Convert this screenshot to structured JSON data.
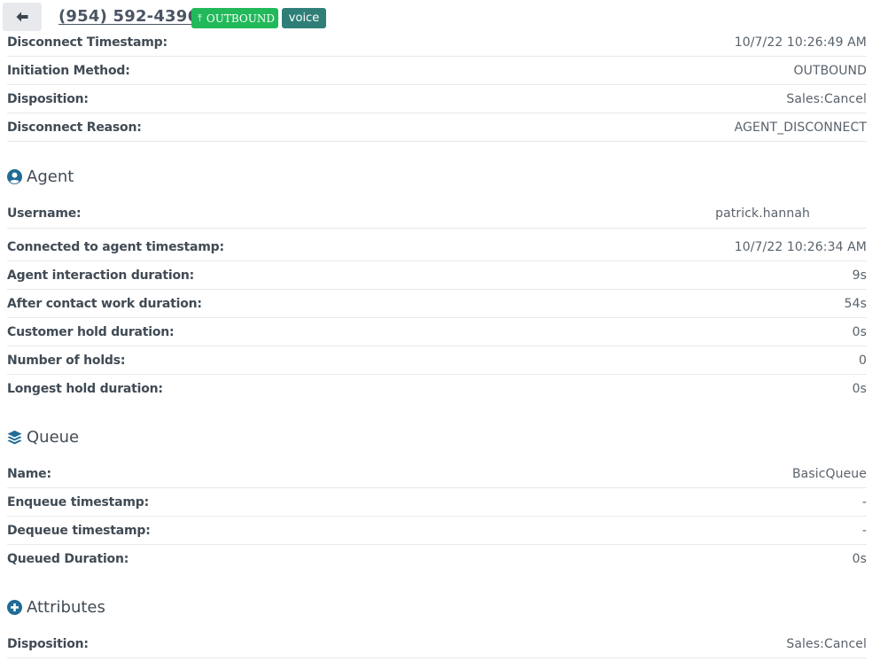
{
  "header": {
    "phone": "(954) 592-4396",
    "badges": {
      "outbound": "OUTBOUND",
      "voice": "voice"
    }
  },
  "contact_rows": [
    {
      "label": "Disconnect Timestamp:",
      "value": "10/7/22 10:26:49 AM"
    },
    {
      "label": "Initiation Method:",
      "value": "OUTBOUND"
    },
    {
      "label": "Disposition:",
      "value": "Sales:Cancel"
    },
    {
      "label": "Disconnect Reason:",
      "value": "AGENT_DISCONNECT"
    }
  ],
  "agent": {
    "title": "Agent",
    "rows": [
      {
        "label": "Username:",
        "value": "patrick.hannah"
      },
      {
        "label": "Connected to agent timestamp:",
        "value": "10/7/22 10:26:34 AM"
      },
      {
        "label": "Agent interaction duration:",
        "value": "9s"
      },
      {
        "label": "After contact work duration:",
        "value": "54s"
      },
      {
        "label": "Customer hold duration:",
        "value": "0s"
      },
      {
        "label": "Number of holds:",
        "value": "0"
      },
      {
        "label": "Longest hold duration:",
        "value": "0s"
      }
    ]
  },
  "queue": {
    "title": "Queue",
    "rows": [
      {
        "label": "Name:",
        "value": "BasicQueue"
      },
      {
        "label": "Enqueue timestamp:",
        "value": "-"
      },
      {
        "label": "Dequeue timestamp:",
        "value": "-"
      },
      {
        "label": "Queued Duration:",
        "value": "0s"
      }
    ]
  },
  "attributes": {
    "title": "Attributes",
    "rows": [
      {
        "label": "Disposition:",
        "value": "Sales:Cancel"
      }
    ]
  },
  "colors": {
    "icon": "#216b96",
    "outbound_badge": "#22b95a",
    "voice_badge": "#2f7f78"
  }
}
